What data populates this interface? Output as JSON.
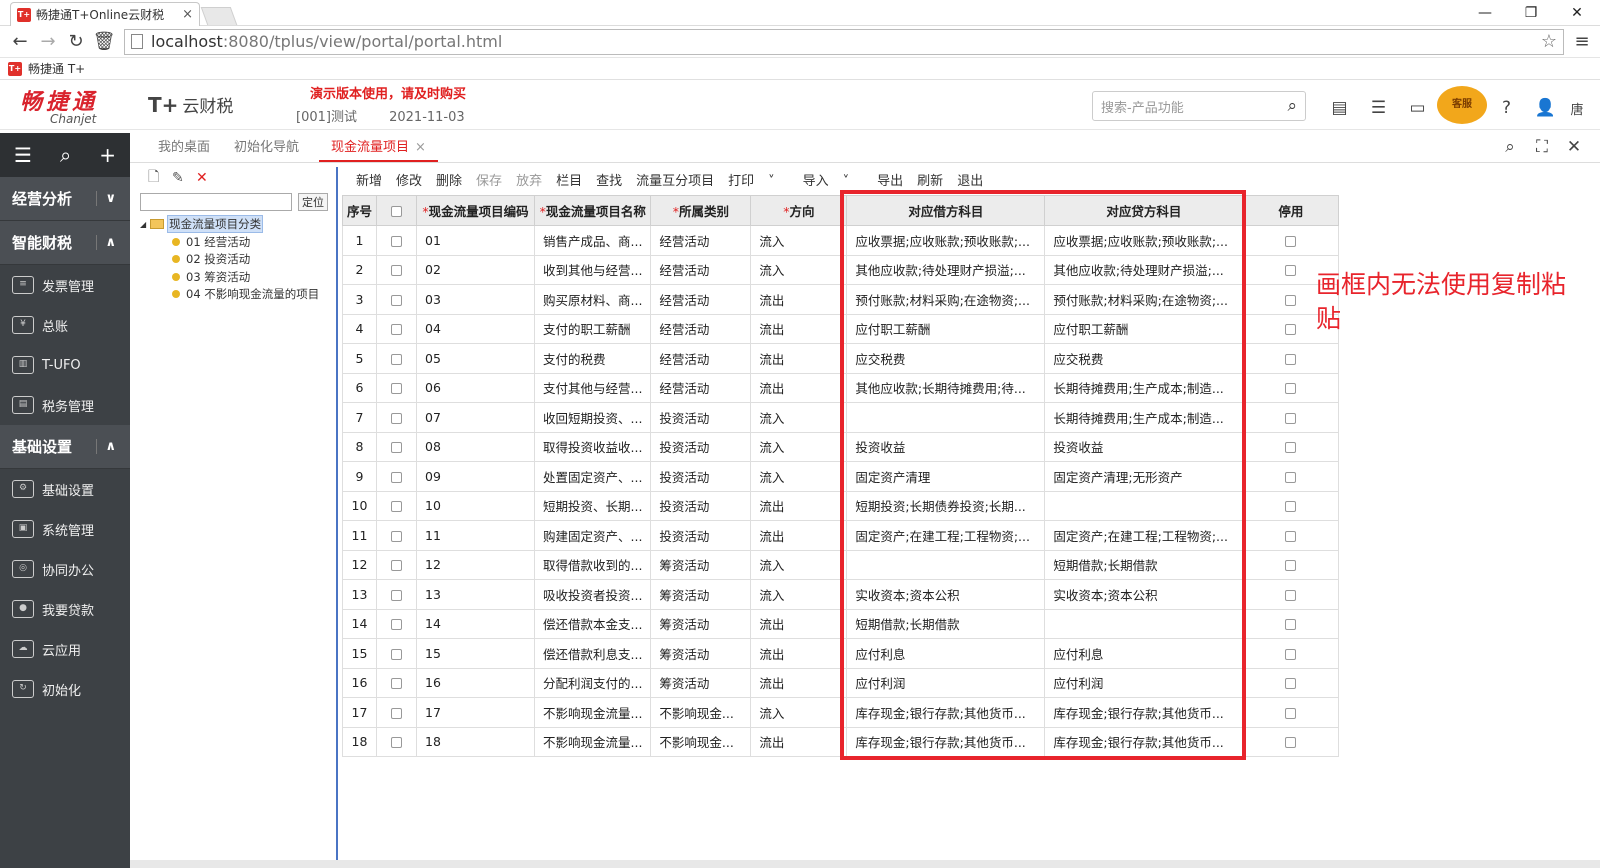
{
  "browser": {
    "tab_title": "畅捷通T+Online云财税",
    "tab_close": "×",
    "fav_text": "T+",
    "url_host": "localhost",
    "url_path": ":8080/tplus/view/portal/portal.html",
    "bookmark": "畅捷通 T+"
  },
  "header": {
    "logo_cn": "畅捷通",
    "logo_en": "Chanjet",
    "product": "T+",
    "product_sub": "云财税",
    "demo_warning": "演示版本使用，请及时购买",
    "account": "[001]测试",
    "date": "2021-11-03",
    "search_placeholder": "搜索-产品功能",
    "user_name": "唐",
    "service_label": "客服"
  },
  "sidebar": {
    "groups": [
      {
        "label": "经营分析"
      },
      {
        "label": "智能财税"
      },
      {
        "label": "基础设置"
      }
    ],
    "finance_items": [
      {
        "label": "发票管理"
      },
      {
        "label": "总账"
      },
      {
        "label": "T-UFO"
      },
      {
        "label": "税务管理"
      }
    ],
    "basic_items": [
      {
        "label": "基础设置"
      },
      {
        "label": "系统管理"
      },
      {
        "label": "协同办公"
      },
      {
        "label": "我要贷款"
      },
      {
        "label": "云应用"
      },
      {
        "label": "初始化"
      }
    ]
  },
  "tabs": {
    "desktop": "我的桌面",
    "init_nav": "初始化导航",
    "active": "现金流量项目",
    "close": "×"
  },
  "leftpanel": {
    "locate_btn": "定位",
    "root": "现金流量项目分类",
    "nodes": [
      "01 经营活动",
      "02 投资活动",
      "03 筹资活动",
      "04 不影响现金流量的项目"
    ]
  },
  "toolbar": {
    "add": "新增",
    "edit": "修改",
    "delete": "删除",
    "save": "保存",
    "discard": "放弃",
    "columns": "栏目",
    "find": "查找",
    "mutual": "流量互分项目",
    "print": "打印",
    "import": "导入",
    "export": "导出",
    "refresh": "刷新",
    "exit": "退出"
  },
  "grid": {
    "headers": {
      "seq": "序号",
      "code": "现金流量项目编码",
      "name": "现金流量项目名称",
      "category": "所属类别",
      "direction": "方向",
      "debit": "对应借方科目",
      "credit": "对应贷方科目",
      "disabled": "停用"
    },
    "rows": [
      {
        "seq": "1",
        "code": "01",
        "name": "销售产成品、商...",
        "category": "经营活动",
        "direction": "流入",
        "debit": "应收票据;应收账款;预收账款;...",
        "credit": "应收票据;应收账款;预收账款;..."
      },
      {
        "seq": "2",
        "code": "02",
        "name": "收到其他与经营...",
        "category": "经营活动",
        "direction": "流入",
        "debit": "其他应收款;待处理财产损溢;...",
        "credit": "其他应收款;待处理财产损溢;..."
      },
      {
        "seq": "3",
        "code": "03",
        "name": "购买原材料、商...",
        "category": "经营活动",
        "direction": "流出",
        "debit": "预付账款;材料采购;在途物资;...",
        "credit": "预付账款;材料采购;在途物资;..."
      },
      {
        "seq": "4",
        "code": "04",
        "name": "支付的职工薪酬",
        "category": "经营活动",
        "direction": "流出",
        "debit": "应付职工薪酬",
        "credit": "应付职工薪酬"
      },
      {
        "seq": "5",
        "code": "05",
        "name": "支付的税费",
        "category": "经营活动",
        "direction": "流出",
        "debit": "应交税费",
        "credit": "应交税费"
      },
      {
        "seq": "6",
        "code": "06",
        "name": "支付其他与经营...",
        "category": "经营活动",
        "direction": "流出",
        "debit": "其他应收款;长期待摊费用;待...",
        "credit": "长期待摊费用;生产成本;制造..."
      },
      {
        "seq": "7",
        "code": "07",
        "name": "收回短期投资、...",
        "category": "投资活动",
        "direction": "流入",
        "debit": "",
        "credit": "长期待摊费用;生产成本;制造..."
      },
      {
        "seq": "8",
        "code": "08",
        "name": "取得投资收益收...",
        "category": "投资活动",
        "direction": "流入",
        "debit": "投资收益",
        "credit": "投资收益"
      },
      {
        "seq": "9",
        "code": "09",
        "name": "处置固定资产、...",
        "category": "投资活动",
        "direction": "流入",
        "debit": "固定资产清理",
        "credit": "固定资产清理;无形资产"
      },
      {
        "seq": "10",
        "code": "10",
        "name": "短期投资、长期...",
        "category": "投资活动",
        "direction": "流出",
        "debit": "短期投资;长期债券投资;长期...",
        "credit": ""
      },
      {
        "seq": "11",
        "code": "11",
        "name": "购建固定资产、...",
        "category": "投资活动",
        "direction": "流出",
        "debit": "固定资产;在建工程;工程物资;...",
        "credit": "固定资产;在建工程;工程物资;..."
      },
      {
        "seq": "12",
        "code": "12",
        "name": "取得借款收到的...",
        "category": "筹资活动",
        "direction": "流入",
        "debit": "",
        "credit": "短期借款;长期借款"
      },
      {
        "seq": "13",
        "code": "13",
        "name": "吸收投资者投资...",
        "category": "筹资活动",
        "direction": "流入",
        "debit": "实收资本;资本公积",
        "credit": "实收资本;资本公积"
      },
      {
        "seq": "14",
        "code": "14",
        "name": "偿还借款本金支...",
        "category": "筹资活动",
        "direction": "流出",
        "debit": "短期借款;长期借款",
        "credit": ""
      },
      {
        "seq": "15",
        "code": "15",
        "name": "偿还借款利息支...",
        "category": "筹资活动",
        "direction": "流出",
        "debit": "应付利息",
        "credit": "应付利息"
      },
      {
        "seq": "16",
        "code": "16",
        "name": "分配利润支付的...",
        "category": "筹资活动",
        "direction": "流出",
        "debit": "应付利润",
        "credit": "应付利润"
      },
      {
        "seq": "17",
        "code": "17",
        "name": "不影响现金流量...",
        "category": "不影响现金...",
        "direction": "流入",
        "debit": "库存现金;银行存款;其他货币...",
        "credit": "库存现金;银行存款;其他货币..."
      },
      {
        "seq": "18",
        "code": "18",
        "name": "不影响现金流量...",
        "category": "不影响现金...",
        "direction": "流出",
        "debit": "库存现金;银行存款;其他货币...",
        "credit": "库存现金;银行存款;其他货币..."
      }
    ]
  },
  "annotation": {
    "text": "画框内无法使用复制粘贴",
    "color": "#e8242c"
  }
}
